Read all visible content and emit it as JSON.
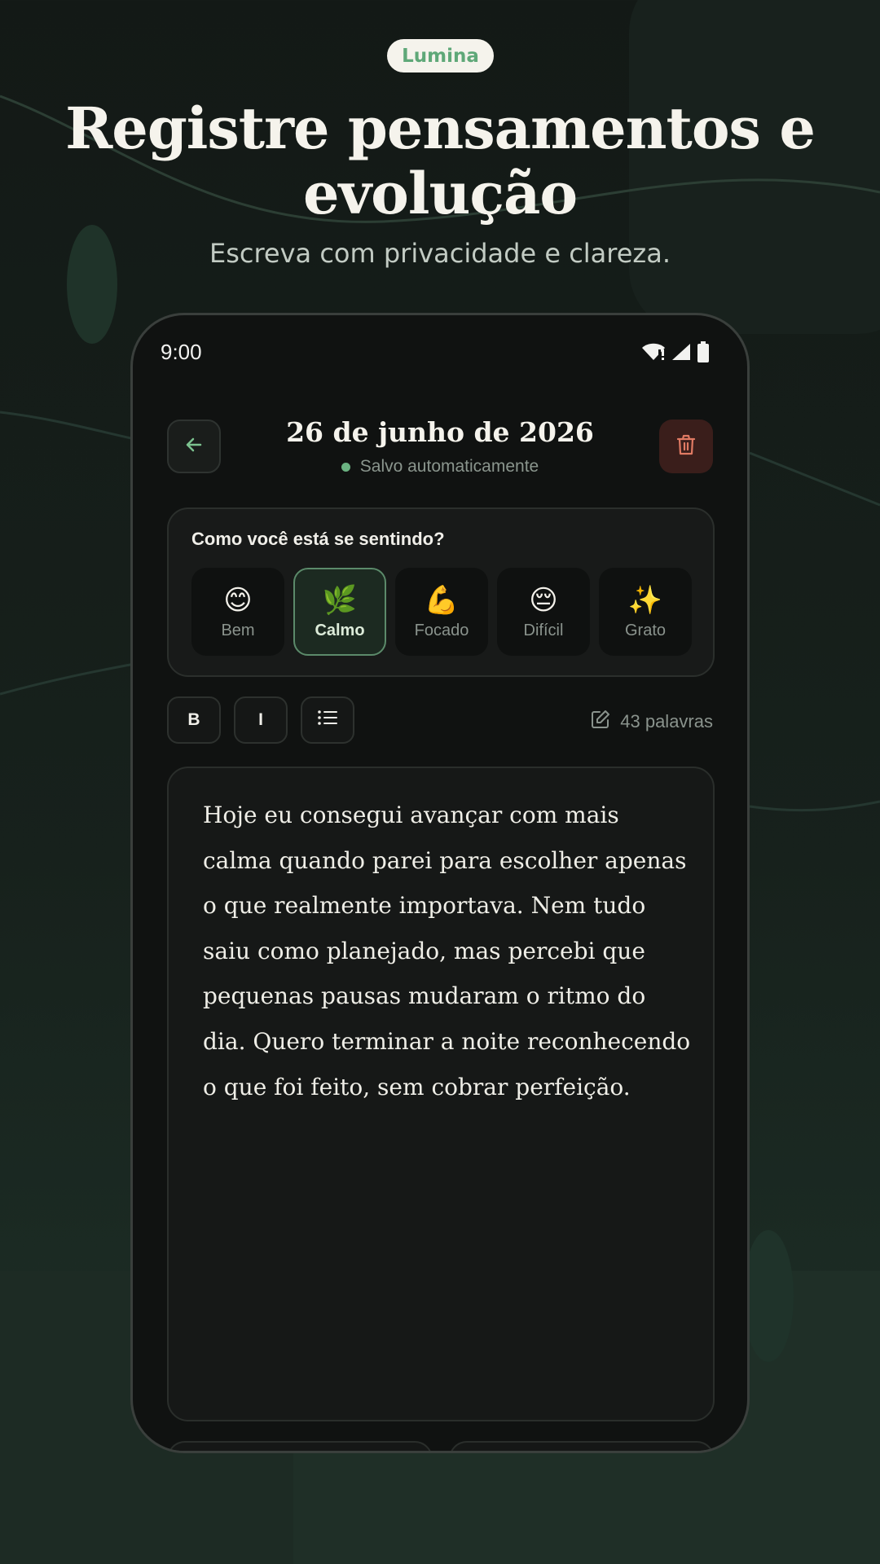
{
  "brand": {
    "name": "Lumina"
  },
  "hero": {
    "title": "Registre pensamentos e evolução",
    "subtitle": "Escreva com privacidade e clareza."
  },
  "status_bar": {
    "time": "9:00",
    "icons": [
      "wifi-alert-icon",
      "signal-icon",
      "battery-icon"
    ]
  },
  "header": {
    "date": "26 de junho de 2026",
    "save_status": "Salvo automaticamente",
    "back_icon": "arrow-left-icon",
    "delete_icon": "trash-icon"
  },
  "mood": {
    "question": "Como você está se sentindo?",
    "selected": "Calmo",
    "options": [
      {
        "emoji": "😊",
        "label": "Bem"
      },
      {
        "emoji": "🌿",
        "label": "Calmo"
      },
      {
        "emoji": "💪",
        "label": "Focado"
      },
      {
        "emoji": "😔",
        "label": "Difícil"
      },
      {
        "emoji": "✨",
        "label": "Grato"
      }
    ]
  },
  "toolbar": {
    "bold_label": "B",
    "italic_label": "I",
    "list_icon": "list-icon",
    "word_count": "43 palavras",
    "word_count_icon": "edit-icon"
  },
  "entry": {
    "text": "Hoje eu consegui avançar com mais calma quando parei para escolher apenas o que realmente importava. Nem tudo saiu como planejado, mas percebi que pequenas pausas mudaram o ritmo do dia. Quero terminar a noite reconhecendo o que foi feito, sem cobrar perfeição."
  },
  "colors": {
    "accent": "#6bb382",
    "brand_text": "#5fa878",
    "danger_bg": "#3a1e1b",
    "danger_icon": "#e07a63",
    "background": "#131916"
  }
}
